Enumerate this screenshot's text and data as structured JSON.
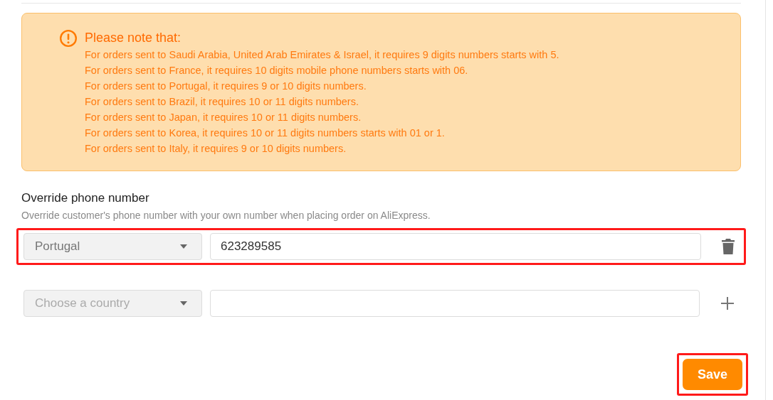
{
  "notice": {
    "title": "Please note that:",
    "lines": [
      "For orders sent to Saudi Arabia, United Arab Emirates & Israel, it requires 9 digits numbers starts with 5.",
      "For orders sent to France, it requires 10 digits mobile phone numbers starts with 06.",
      "For orders sent to Portugal, it requires 9 or 10 digits numbers.",
      "For orders sent to Brazil, it requires 10 or 11 digits numbers.",
      "For orders sent to Japan, it requires 10 or 11 digits numbers.",
      "For orders sent to Korea, it requires 10 or 11 digits numbers starts with 01 or 1.",
      "For orders sent to Italy, it requires 9 or 10 digits numbers."
    ]
  },
  "section": {
    "title": "Override phone number",
    "description": "Override customer's phone number with your own number when placing order on AliExpress."
  },
  "rows": [
    {
      "country": "Portugal",
      "phone": "623289585",
      "kind": "delete",
      "highlighted": true
    },
    {
      "country_placeholder": "Choose a country",
      "kind": "add",
      "highlighted": false
    }
  ],
  "save_button": {
    "label": "Save",
    "highlighted": true
  }
}
